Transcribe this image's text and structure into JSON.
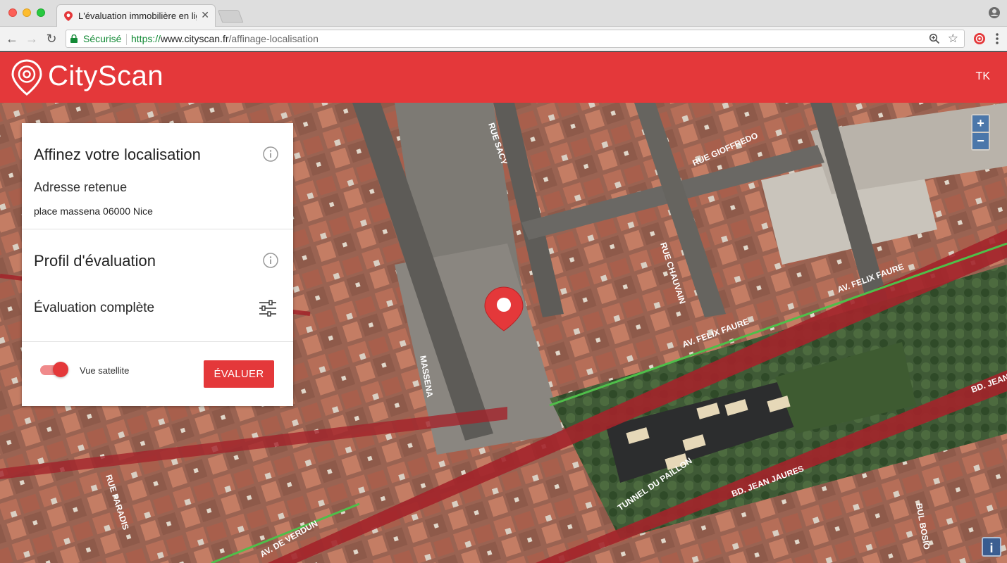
{
  "browser": {
    "tab_title": "L'évaluation immobilière en lig",
    "secure_label": "Sécurisé",
    "url_protocol": "https://",
    "url_host": "www.cityscan.fr",
    "url_path": "/affinage-localisation"
  },
  "header": {
    "logo_text": "CityScan",
    "user_initials": "TK"
  },
  "panel": {
    "title": "Affinez votre localisation",
    "address_heading": "Adresse retenue",
    "address_value": "place massena 06000 Nice",
    "profile_heading": "Profil d'évaluation",
    "profile_value": "Évaluation complète",
    "toggle_label": "Vue satellite",
    "toggle_on": true,
    "evaluate_button": "ÉVALUER"
  },
  "map": {
    "zoom_in": "+",
    "zoom_out": "−",
    "info": "i",
    "street_labels": [
      "RUE GIOFFREDO",
      "RUE CHAUVAIN",
      "RUE SACY",
      "AV. FELIX FAURE",
      "AV. FELIX FAURE",
      "BD. JEAN",
      "BD. JEAN JAURES",
      "TUNNEL DU PAILLON",
      "AV. DE VERDUN",
      "RUE PARADIS",
      "BUL BOSIO",
      "MASSENA"
    ]
  },
  "colors": {
    "brand_red": "#e4383a",
    "secure_green": "#138a36"
  }
}
